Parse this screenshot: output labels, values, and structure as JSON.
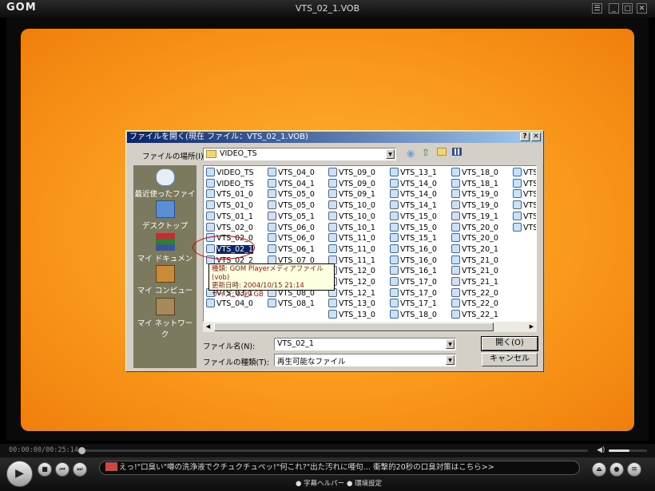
{
  "app": {
    "logo": "GOM",
    "window_title": "VTS_02_1.VOB"
  },
  "window_buttons": {
    "playlist": "☰",
    "minimize": "_",
    "maximize": "□",
    "close": "✕"
  },
  "dialog": {
    "title": "ファイルを開く(現在 ファイル：VTS_02_1.VOB)",
    "help": "?",
    "close": "✕",
    "look_in_label": "ファイルの場所(I):",
    "look_in_value": "VIDEO_TS",
    "places": [
      "最近使ったファイル",
      "デスクトップ",
      "マイ ドキュメント",
      "マイ コンピュータ",
      "マイ ネットワーク"
    ],
    "file_columns": [
      [
        "VIDEO_TS",
        "VIDEO_TS",
        "VTS_01_0",
        "VTS_01_0",
        "VTS_01_1",
        "VTS_02_0",
        "VTS_02_0",
        "VTS_02_1",
        "VTS_02_2",
        "",
        "",
        "VTS_03_1",
        "VTS_04_0"
      ],
      [
        "VTS_04_0",
        "VTS_04_1",
        "VTS_05_0",
        "VTS_05_0",
        "VTS_05_1",
        "VTS_06_0",
        "VTS_06_0",
        "VTS_06_1",
        "VTS_07_0",
        "",
        "",
        "VTS_08_0",
        "VTS_08_1"
      ],
      [
        "VTS_09_0",
        "VTS_09_0",
        "VTS_09_1",
        "VTS_10_0",
        "VTS_10_0",
        "VTS_10_1",
        "VTS_11_0",
        "VTS_11_0",
        "VTS_11_1",
        "VTS_12_0",
        "VTS_12_0",
        "VTS_12_1",
        "VTS_13_0",
        "VTS_13_0"
      ],
      [
        "VTS_13_1",
        "VTS_14_0",
        "VTS_14_0",
        "VTS_14_1",
        "VTS_15_0",
        "VTS_15_0",
        "VTS_15_1",
        "VTS_16_0",
        "VTS_16_0",
        "VTS_16_1",
        "VTS_17_0",
        "VTS_17_0",
        "VTS_17_1",
        "VTS_18_0"
      ],
      [
        "VTS_18_0",
        "VTS_18_1",
        "VTS_19_0",
        "VTS_19_0",
        "VTS_19_1",
        "VTS_20_0",
        "VTS_20_0",
        "VTS_20_1",
        "VTS_21_0",
        "VTS_21_0",
        "VTS_21_1",
        "VTS_22_0",
        "VTS_22_0",
        "VTS_22_1"
      ],
      [
        "VTS",
        "VTS",
        "VTS",
        "VTS",
        "VTS",
        "VTS"
      ]
    ],
    "selected_file": "VTS_02_1",
    "tooltip": {
      "type": "種類: GOM Playerメディアファイル(vob)",
      "modified": "更新日時: 2004/10/15 21:14",
      "size": "サイズ: 0.99 GB"
    },
    "filename_label": "ファイル名(N):",
    "filename_value": "VTS_02_1",
    "filetype_label": "ファイルの種類(T):",
    "filetype_value": "再生可能なファイル",
    "open_button": "開く(O)",
    "cancel_button": "キャンセル"
  },
  "player": {
    "time": "00:00:00/00:25:14",
    "ticker": "えっ!\"口臭い\"噂の洗浄液でクチュクチュペッ!\"何これ?\"出た汚れに唖句… 衝撃的20秒の口臭対策はこちら>>",
    "subtitle_help": "字幕ヘルパー",
    "settings": "環境設定",
    "progress_fraction": 0.0,
    "volume_fraction": 0.55
  },
  "colors": {
    "stage_orange": "#f9981c",
    "dialog_title_blue": "#0a246a",
    "places_bar": "#7b7a5e"
  }
}
